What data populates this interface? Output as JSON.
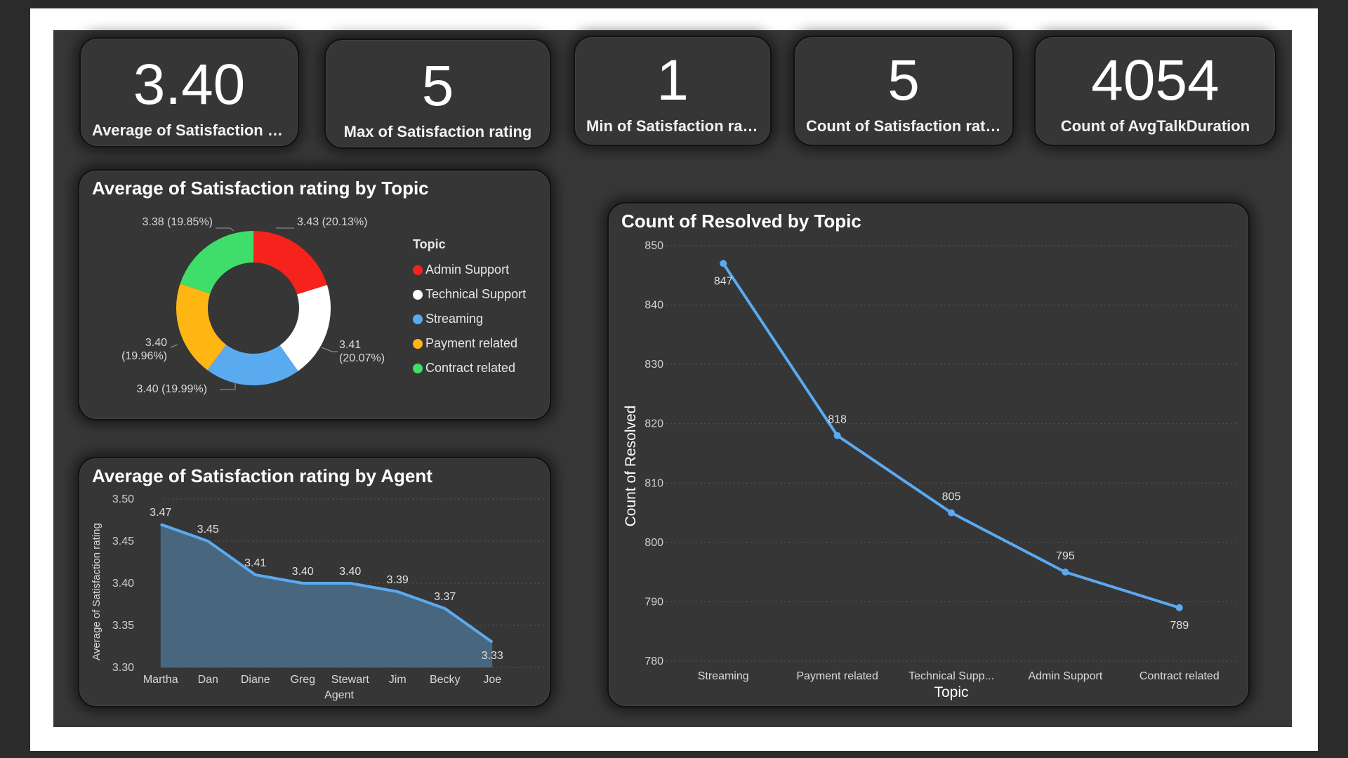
{
  "kpis": [
    {
      "value": "3.40",
      "label": "Average of Satisfaction rating"
    },
    {
      "value": "5",
      "label": "Max of Satisfaction rating"
    },
    {
      "value": "1",
      "label": "Min of Satisfaction rating"
    },
    {
      "value": "5",
      "label": "Count of Satisfaction rating"
    },
    {
      "value": "4054",
      "label": "Count of AvgTalkDuration"
    }
  ],
  "topic_chart": {
    "title": "Average of Satisfaction rating by Topic",
    "legend_title": "Topic"
  },
  "agent_chart": {
    "title": "Average of Satisfaction rating by Agent"
  },
  "resolved_chart": {
    "title": "Count of Resolved by Topic"
  },
  "colors": {
    "accent": "#5aaaf0",
    "background": "#373737",
    "card": "#363636"
  },
  "chart_data": [
    {
      "type": "pie",
      "title": "Average of Satisfaction rating by Topic",
      "legend_title": "Topic",
      "legend_position": "right",
      "donut": true,
      "categories": [
        "Admin Support",
        "Technical Support",
        "Streaming",
        "Payment related",
        "Contract related"
      ],
      "values": [
        3.43,
        3.41,
        3.4,
        3.4,
        3.38
      ],
      "labels": [
        "3.43 (20.13%)",
        "3.41 (20.07%)",
        "3.40 (19.99%)",
        "3.40 (19.96%)",
        "3.38 (19.85%)"
      ],
      "percents": [
        20.13,
        20.07,
        19.99,
        19.96,
        19.85
      ],
      "colors": [
        "#f5231b",
        "#ffffff",
        "#5aaaf0",
        "#ffb612",
        "#3fde6a"
      ]
    },
    {
      "type": "area",
      "title": "Average of Satisfaction rating by Agent",
      "xlabel": "Agent",
      "ylabel": "Average of Satisfaction rating",
      "categories": [
        "Martha",
        "Dan",
        "Diane",
        "Greg",
        "Stewart",
        "Jim",
        "Becky",
        "Joe"
      ],
      "values": [
        3.47,
        3.45,
        3.41,
        3.4,
        3.4,
        3.39,
        3.37,
        3.33
      ],
      "ylim": [
        3.3,
        3.5
      ],
      "yticks": [
        "3.30",
        "3.35",
        "3.40",
        "3.45",
        "3.50"
      ],
      "grid": true,
      "color": "#5aaaf0"
    },
    {
      "type": "line",
      "title": "Count of Resolved by Topic",
      "xlabel": "Topic",
      "ylabel": "Count of Resolved",
      "categories": [
        "Streaming",
        "Payment related",
        "Technical Supp...",
        "Admin Support",
        "Contract related"
      ],
      "values": [
        847,
        818,
        805,
        795,
        789
      ],
      "ylim": [
        780,
        850
      ],
      "yticks": [
        "780",
        "790",
        "800",
        "810",
        "820",
        "830",
        "840",
        "850"
      ],
      "grid": true,
      "color": "#5aaaf0"
    }
  ]
}
